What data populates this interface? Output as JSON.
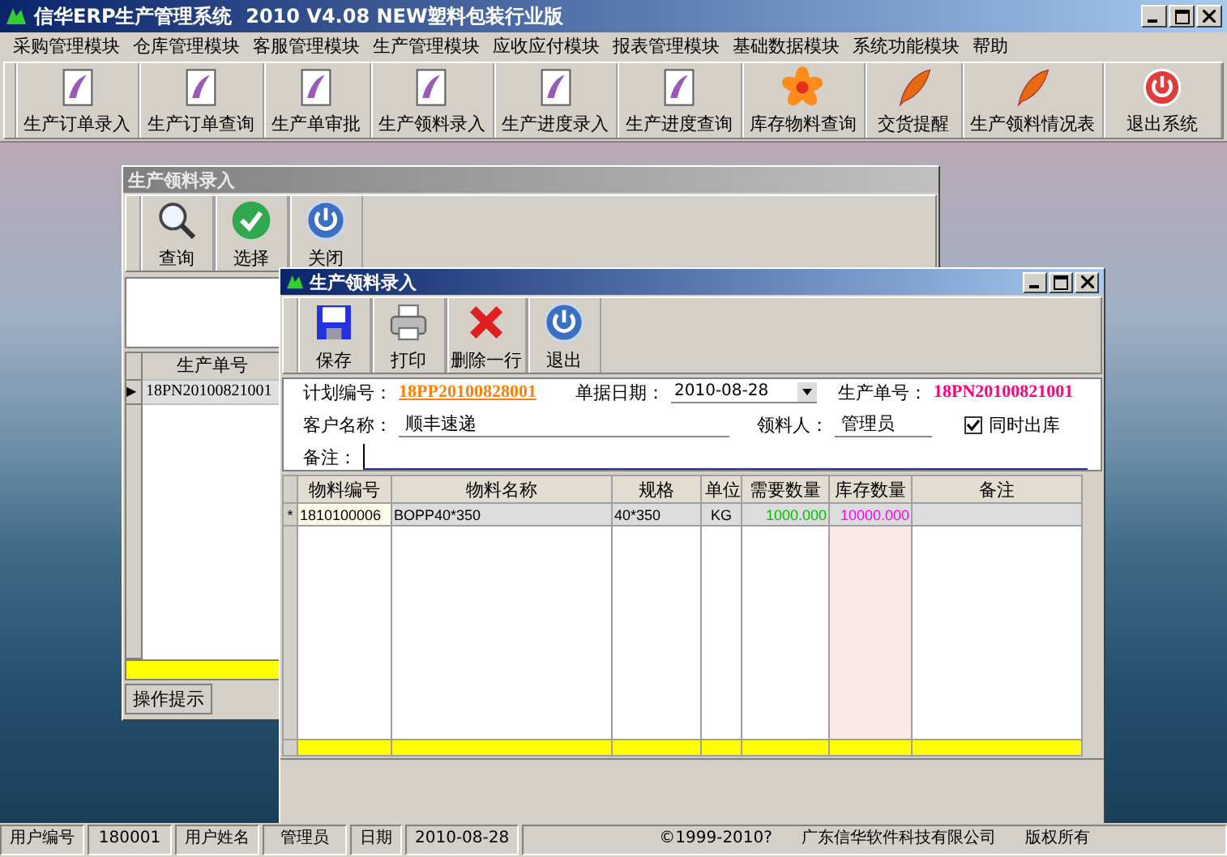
{
  "window": {
    "title": "信华ERP生产管理系统  2010 V4.08 NEW塑料包装行业版"
  },
  "menu": [
    {
      "label": "采购管理模块"
    },
    {
      "label": "仓库管理模块"
    },
    {
      "label": "客服管理模块"
    },
    {
      "label": "生产管理模块"
    },
    {
      "label": "应收应付模块"
    },
    {
      "label": "报表管理模块"
    },
    {
      "label": "基础数据模块"
    },
    {
      "label": "系统功能模块"
    },
    {
      "label": "帮助"
    }
  ],
  "toolbar": [
    {
      "label": "生产订单录入",
      "kind": "document"
    },
    {
      "label": "生产订单查询",
      "kind": "document"
    },
    {
      "label": "生产单审批",
      "kind": "document"
    },
    {
      "label": "生产领料录入",
      "kind": "document"
    },
    {
      "label": "生产进度录入",
      "kind": "document"
    },
    {
      "label": "生产进度查询",
      "kind": "document"
    },
    {
      "label": "库存物料查询",
      "kind": "flower"
    },
    {
      "label": "交货提醒",
      "kind": "feather"
    },
    {
      "label": "生产领料情况表",
      "kind": "feather"
    },
    {
      "label": "退出系统",
      "kind": "shutdown"
    }
  ],
  "back_window": {
    "title": "生产领料录入",
    "active": false,
    "toolbar": [
      {
        "label": "查询",
        "kind": "search"
      },
      {
        "label": "选择",
        "kind": "check"
      },
      {
        "label": "关闭",
        "kind": "power"
      }
    ],
    "table": {
      "columns": [
        "生产单号"
      ],
      "rows": [
        {
          "marker": "▶",
          "cells": [
            "18PN20100821001"
          ]
        }
      ]
    },
    "tabs": [
      {
        "label": "操作提示"
      }
    ]
  },
  "front_window": {
    "title": "生产领料录入",
    "active": true,
    "toolbar": [
      {
        "label": "保存",
        "kind": "save"
      },
      {
        "label": "打印",
        "kind": "print"
      },
      {
        "label": "删除一行",
        "kind": "delete"
      },
      {
        "label": "退出",
        "kind": "power"
      }
    ],
    "form": {
      "fields": [
        {
          "label": "计划编号：",
          "value": "18PP20100828001",
          "kind": "link",
          "color": "#ff8000"
        },
        {
          "label": "单据日期：",
          "value": "2010-08-28",
          "kind": "dropdown"
        },
        {
          "label": "生产单号：",
          "value": "18PN20100821001",
          "kind": "text",
          "color": "#ff0080"
        },
        {
          "label": "客户名称：",
          "value": "顺丰速递",
          "kind": "input"
        },
        {
          "label": "领料人：",
          "value": "管理员",
          "kind": "input"
        },
        {
          "label": "同时出库",
          "kind": "checkbox",
          "checked": true
        },
        {
          "label": "备注：",
          "kind": "input"
        }
      ]
    },
    "grid": {
      "columns": [
        {
          "label": "物料编号"
        },
        {
          "label": "物料名称"
        },
        {
          "label": "规格"
        },
        {
          "label": "单位"
        },
        {
          "label": "需要数量",
          "color": "#00c000"
        },
        {
          "label": "库存数量",
          "color": "#ff00ff"
        },
        {
          "label": "备注"
        }
      ],
      "rows": [
        {
          "marker": "*",
          "cells": [
            "1810100006",
            "BOPP40*350",
            "40*350",
            "KG",
            "1000.000",
            "10000.000"
          ]
        }
      ]
    }
  },
  "status_bar": [
    {
      "label": "用户编号",
      "value": "180001"
    },
    {
      "label": "用户姓名",
      "value": "管理员"
    },
    {
      "label": "日期",
      "value": "2010-08-28"
    }
  ],
  "status_notes": [
    "©1999-2010?",
    "广东信华软件科技有限公司",
    "版权所有"
  ]
}
